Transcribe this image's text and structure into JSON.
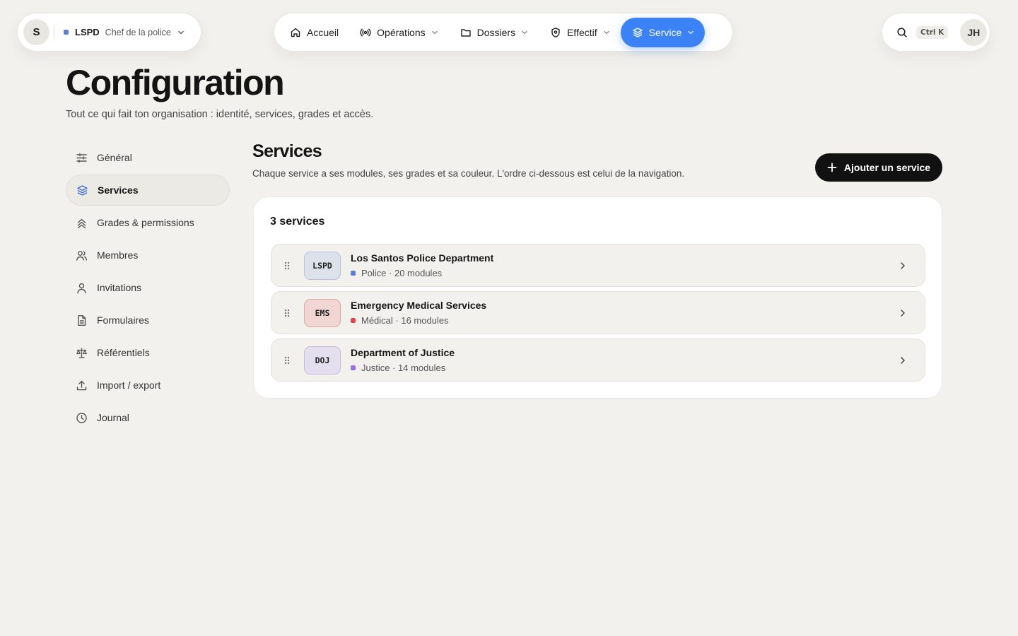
{
  "org": {
    "avatar_letter": "S",
    "name": "LSPD",
    "role": "Chef de la police",
    "dot_color": "#5b7fd6"
  },
  "nav": {
    "items": [
      {
        "label": "Accueil",
        "icon": "home-icon",
        "has_menu": false
      },
      {
        "label": "Opérations",
        "icon": "broadcast-icon",
        "has_menu": true
      },
      {
        "label": "Dossiers",
        "icon": "folder-icon",
        "has_menu": true
      },
      {
        "label": "Effectif",
        "icon": "shield-icon",
        "has_menu": true
      },
      {
        "label": "Service",
        "icon": "layers-icon",
        "has_menu": true,
        "active": true
      }
    ],
    "accent_color": "#3b82f6"
  },
  "topright": {
    "shortcut": "Ctrl K",
    "user_initials": "JH"
  },
  "page": {
    "title": "Configuration",
    "subtitle": "Tout ce qui fait ton organisation : identité, services, grades et accès."
  },
  "sidebar": {
    "items": [
      {
        "label": "Général",
        "icon": "sliders-icon"
      },
      {
        "label": "Services",
        "icon": "layers-icon",
        "active": true
      },
      {
        "label": "Grades & permissions",
        "icon": "chevrons-up-icon"
      },
      {
        "label": "Membres",
        "icon": "users-icon"
      },
      {
        "label": "Invitations",
        "icon": "user-icon"
      },
      {
        "label": "Formulaires",
        "icon": "file-icon"
      },
      {
        "label": "Référentiels",
        "icon": "scale-icon"
      },
      {
        "label": "Import / export",
        "icon": "upload-icon"
      },
      {
        "label": "Journal",
        "icon": "clock-icon"
      }
    ]
  },
  "services_section": {
    "title": "Services",
    "subtitle": "Chaque service a ses modules, ses grades et sa couleur. L'ordre ci-dessous est celui de la navigation.",
    "add_button": "Ajouter un service",
    "count_label": "3 services",
    "items": [
      {
        "code": "LSPD",
        "name": "Los Santos Police Department",
        "meta": "Police · 20 modules",
        "color": "#5b7fd6",
        "badge_bg": "#dde1ea",
        "badge_border": "#b9c3d8"
      },
      {
        "code": "EMS",
        "name": "Emergency Medical Services",
        "meta": "Médical · 16 modules",
        "color": "#e0464a",
        "badge_bg": "#f1d6d3",
        "badge_border": "#e0a9a4"
      },
      {
        "code": "DOJ",
        "name": "Department of Justice",
        "meta": "Justice · 14 modules",
        "color": "#9b6fe0",
        "badge_bg": "#e4dfee",
        "badge_border": "#c6badf"
      }
    ]
  }
}
